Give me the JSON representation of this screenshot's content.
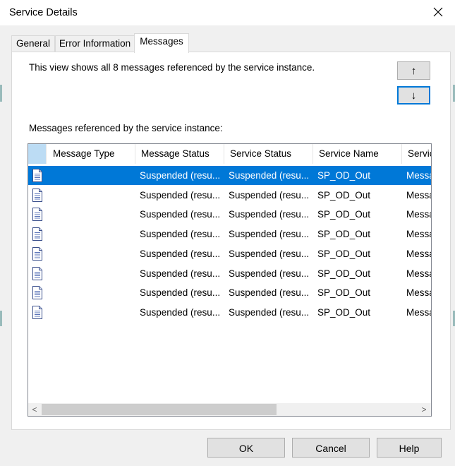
{
  "window": {
    "title": "Service Details"
  },
  "tabs": [
    {
      "label": "General"
    },
    {
      "label": "Error Information"
    },
    {
      "label": "Messages"
    }
  ],
  "intro": "This view shows all 8 messages referenced by the service instance.",
  "move_up": "↑",
  "move_down": "↓",
  "list_label": "Messages referenced by the service instance:",
  "columns": [
    "",
    "Message Type",
    "Message Status",
    "Service Status",
    "Service Name",
    "Servic"
  ],
  "rows": [
    {
      "type": "",
      "message_status": "Suspended (resu...",
      "service_status": "Suspended (resu...",
      "service_name": "SP_OD_Out",
      "service_class": "Messa"
    },
    {
      "type": "",
      "message_status": "Suspended (resu...",
      "service_status": "Suspended (resu...",
      "service_name": "SP_OD_Out",
      "service_class": "Messa"
    },
    {
      "type": "",
      "message_status": "Suspended (resu...",
      "service_status": "Suspended (resu...",
      "service_name": "SP_OD_Out",
      "service_class": "Messa"
    },
    {
      "type": "",
      "message_status": "Suspended (resu...",
      "service_status": "Suspended (resu...",
      "service_name": "SP_OD_Out",
      "service_class": "Messa"
    },
    {
      "type": "",
      "message_status": "Suspended (resu...",
      "service_status": "Suspended (resu...",
      "service_name": "SP_OD_Out",
      "service_class": "Messa"
    },
    {
      "type": "",
      "message_status": "Suspended (resu...",
      "service_status": "Suspended (resu...",
      "service_name": "SP_OD_Out",
      "service_class": "Messa"
    },
    {
      "type": "",
      "message_status": "Suspended (resu...",
      "service_status": "Suspended (resu...",
      "service_name": "SP_OD_Out",
      "service_class": "Messa"
    },
    {
      "type": "",
      "message_status": "Suspended (resu...",
      "service_status": "Suspended (resu...",
      "service_name": "SP_OD_Out",
      "service_class": "Messa"
    }
  ],
  "selected_row": 1,
  "scroll_left": "<",
  "scroll_right": ">",
  "buttons": {
    "ok": "OK",
    "cancel": "Cancel",
    "help": "Help"
  },
  "colors": {
    "selection": "#0078d7",
    "header_accent": "#bcdcf4",
    "focus": "#0078d7"
  },
  "icons": {
    "row": "document-icon",
    "close": "close-icon"
  }
}
